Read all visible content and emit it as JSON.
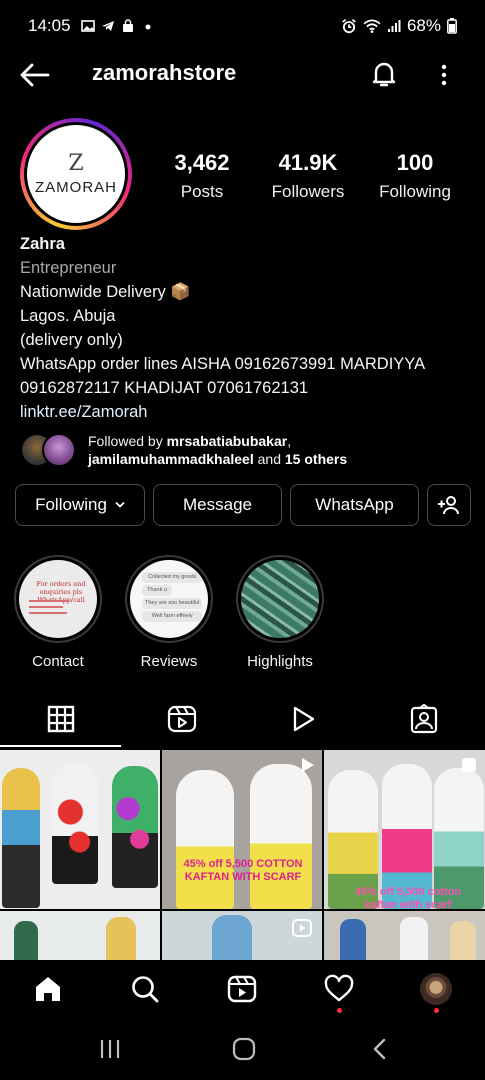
{
  "status": {
    "time": "14:05",
    "battery": "68%",
    "left_icons": [
      "gallery-icon",
      "telegram-icon",
      "shopping-bag-icon",
      "dot-icon"
    ],
    "right_icons": [
      "alarm-icon",
      "wifi-icon",
      "signal-icon",
      "battery-icon"
    ]
  },
  "header": {
    "username": "zamorahstore"
  },
  "profile": {
    "avatar_letter": "Z",
    "avatar_brand": "ZAMORAH",
    "stats": [
      {
        "value": "3,462",
        "label": "Posts"
      },
      {
        "value": "41.9K",
        "label": "Followers"
      },
      {
        "value": "100",
        "label": "Following"
      }
    ],
    "name": "Zahra",
    "category": "Entrepreneur",
    "bio_lines": [
      "Nationwide Delivery 📦",
      "Lagos. Abuja",
      "(delivery only)",
      "WhatsApp order lines AISHA 09162673991 MARDIYYA 09162872117 KHADIJAT 07061762131"
    ],
    "link": "linktr.ee/Zamorah",
    "followed_by": {
      "prefix": "Followed by ",
      "user1": "mrsabatiabubakar",
      "sep": ",",
      "user2": "jamilamuhammadkhaleel",
      "mid": " and ",
      "others": "15 others"
    }
  },
  "buttons": {
    "following": "Following",
    "message": "Message",
    "whatsapp": "WhatsApp"
  },
  "highlights": [
    {
      "label": "Contact",
      "cover_text": "For orders and enquiries pls WhatsApp/call"
    },
    {
      "label": "Reviews",
      "cover_lines": [
        "Collected my goods",
        "Thank u",
        "They are soo beautiful",
        "Well farm effeely"
      ]
    },
    {
      "label": "Highlights"
    }
  ],
  "tabs": [
    "grid-icon",
    "reels-icon",
    "play-icon",
    "tagged-icon"
  ],
  "posts": [
    {
      "caption": ""
    },
    {
      "caption": "45% off 5,500 COTTON KAFTAN WITH SCARF"
    },
    {
      "caption": "45% off 5,500 cotton kaftan with scarf"
    }
  ],
  "colors": {
    "background": "#000000",
    "text": "#f5f5f5",
    "muted": "#a8a8a8",
    "link": "#e0f1ff",
    "button_border": "#4a4a4a",
    "notification_dot": "#ff3040"
  }
}
